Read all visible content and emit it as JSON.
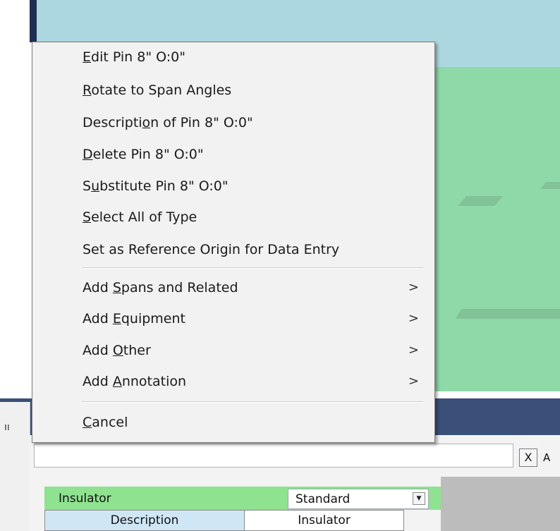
{
  "menu": {
    "items": [
      {
        "label": "Edit Pin 8\" O:0\"",
        "mnemonic_index": 0,
        "submenu": false
      },
      {
        "label": "Rotate to Span Angles",
        "mnemonic_index": 0,
        "submenu": false
      },
      {
        "label": "Description of Pin 8\" O:0\"",
        "mnemonic_index": 9,
        "submenu": false
      },
      {
        "label": "Delete Pin 8\" O:0\"",
        "mnemonic_index": 0,
        "submenu": false
      },
      {
        "label": "Substitute Pin 8\" O:0\"",
        "mnemonic_index": 1,
        "submenu": false
      },
      {
        "label": "Select All of Type",
        "mnemonic_index": 0,
        "submenu": false
      },
      {
        "label": "Set as Reference Origin for Data Entry",
        "mnemonic_index": -1,
        "submenu": false
      },
      {
        "label": "Add Spans and Related",
        "mnemonic_index": 4,
        "submenu": true
      },
      {
        "label": "Add Equipment",
        "mnemonic_index": 4,
        "submenu": true
      },
      {
        "label": "Add Other",
        "mnemonic_index": 4,
        "submenu": true
      },
      {
        "label": "Add Annotation",
        "mnemonic_index": 4,
        "submenu": true
      },
      {
        "label": "Cancel",
        "mnemonic_index": 0,
        "submenu": false
      }
    ],
    "submenu_glyph": ">"
  },
  "panel": {
    "left_tab_glyph": "ıı",
    "search_value": "",
    "clear_label": "X",
    "clear_side_text": "A",
    "property_label": "Insulator",
    "property_value": "Standard",
    "grid_headers": [
      "Description",
      "Insulator"
    ]
  },
  "colors": {
    "sky": "#acd7e0",
    "ground": "#8fd9a8",
    "panel_title": "#3a5078",
    "property_row": "#8fe28f"
  }
}
